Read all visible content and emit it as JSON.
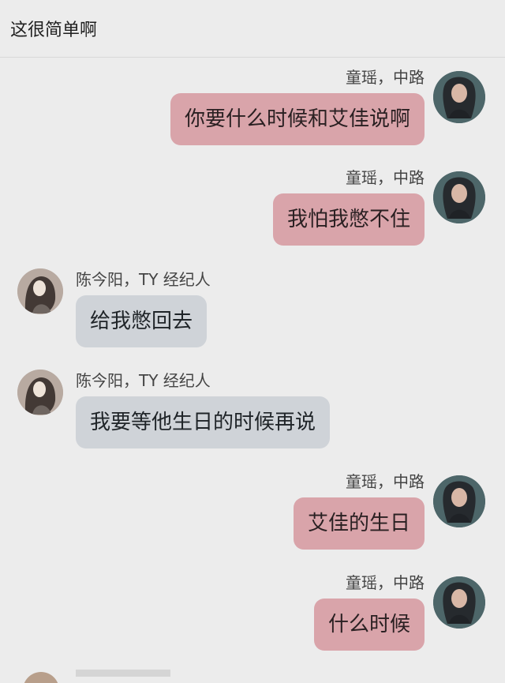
{
  "chat_title": "这很简单啊",
  "messages": [
    {
      "side": "right",
      "sender": "童瑶，中路",
      "text": "你要什么时候和艾佳说啊"
    },
    {
      "side": "right",
      "sender": "童瑶，中路",
      "text": "我怕我憋不住"
    },
    {
      "side": "left",
      "sender": "陈今阳，TY 经纪人",
      "text": "给我憋回去"
    },
    {
      "side": "left",
      "sender": "陈今阳，TY 经纪人",
      "text": "我要等他生日的时候再说"
    },
    {
      "side": "right",
      "sender": "童瑶，中路",
      "text": "艾佳的生日"
    },
    {
      "side": "right",
      "sender": "童瑶，中路",
      "text": "什么时候"
    }
  ]
}
